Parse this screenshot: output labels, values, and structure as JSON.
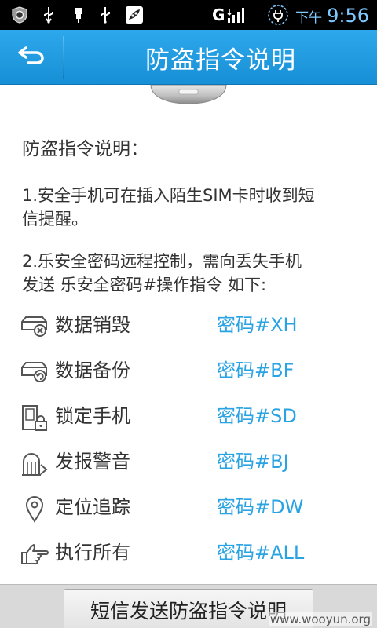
{
  "status_bar": {
    "network": "G",
    "ampm": "下午",
    "time": "9:56"
  },
  "header": {
    "title": "防盗指令说明"
  },
  "content": {
    "section_title": "防盗指令说明：",
    "para1_line1": "1.安全手机可在插入陌生SIM卡时收到短",
    "para1_line2": "信提醒。",
    "para2_line1": "2.乐安全密码远程控制，需向丢失手机",
    "para2_line2": "发送 乐安全密码#操作指令 如下:",
    "commands": [
      {
        "label": "数据销毁",
        "code": "密码#XH",
        "icon": "drive-erase-icon"
      },
      {
        "label": "数据备份",
        "code": "密码#BF",
        "icon": "drive-backup-icon"
      },
      {
        "label": "锁定手机",
        "code": "密码#SD",
        "icon": "phone-lock-icon"
      },
      {
        "label": "发报警音",
        "code": "密码#BJ",
        "icon": "alarm-sound-icon"
      },
      {
        "label": "定位追踪",
        "code": "密码#DW",
        "icon": "location-pin-icon"
      },
      {
        "label": "执行所有",
        "code": "密码#ALL",
        "icon": "hand-pointing-icon"
      }
    ]
  },
  "footer": {
    "send_button": "短信发送防盗指令说明",
    "watermark": "www.wooyun.org"
  },
  "colors": {
    "title_bar": "#1e9ae0",
    "code_text": "#2aa3e3",
    "status_time": "#7fc9ff"
  }
}
